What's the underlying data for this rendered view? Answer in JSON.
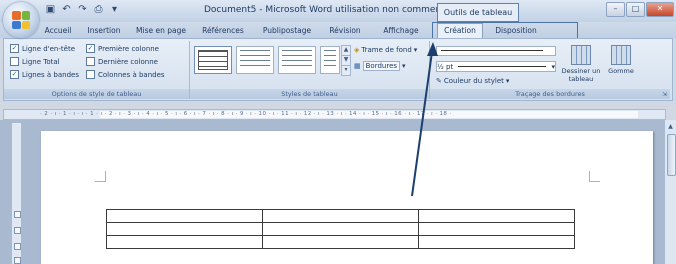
{
  "window": {
    "title": "Document5 - Microsoft Word utilisation non commerciale",
    "context_tab_title": "Outils de tableau"
  },
  "qat": {
    "icons": [
      "save-icon",
      "undo-icon",
      "redo-icon",
      "print-preview-icon",
      "customize-icon"
    ]
  },
  "tabs": [
    {
      "label": "Accueil"
    },
    {
      "label": "Insertion"
    },
    {
      "label": "Mise en page"
    },
    {
      "label": "Références"
    },
    {
      "label": "Publipostage"
    },
    {
      "label": "Révision"
    },
    {
      "label": "Affichage"
    },
    {
      "label": "Création"
    },
    {
      "label": "Disposition"
    }
  ],
  "active_tab": "Création",
  "ribbon": {
    "options_group": {
      "label": "Options de style de tableau",
      "options": [
        {
          "label": "Ligne d'en-tête",
          "checked": true
        },
        {
          "label": "Première colonne",
          "checked": true
        },
        {
          "label": "Ligne Total",
          "checked": false
        },
        {
          "label": "Dernière colonne",
          "checked": false
        },
        {
          "label": "Lignes à bandes",
          "checked": true
        },
        {
          "label": "Colonnes à bandes",
          "checked": false
        }
      ]
    },
    "styles_group": {
      "label": "Styles de tableau",
      "shading_label": "Trame de fond",
      "borders_label": "Bordures"
    },
    "borders_group": {
      "label": "Traçage des bordures",
      "pen_weight": "½ pt",
      "pen_color_label": "Couleur du stylet",
      "draw_table_label": "Dessiner un tableau",
      "eraser_label": "Gomme"
    }
  },
  "ruler": {
    "ticks": "· 2 · ı · 1 · ı ·  ı · 1 · ı · 2 · ı · 3 · ı · 4 · ı · 5 · ı · 6 · ı · 7 · ı · 8 · ı · 9 · ı · 10 · ı · 11 · ı · 12 · ı · 13 · ı · 14 · ı · 15 · ı · 16 · ı · 17 · ı · 18 ·"
  },
  "document": {
    "table": {
      "rows": 3,
      "cols": 3
    }
  },
  "colors": {
    "arrow": "#1c3f6e",
    "context_outline": "#4c74a8"
  }
}
